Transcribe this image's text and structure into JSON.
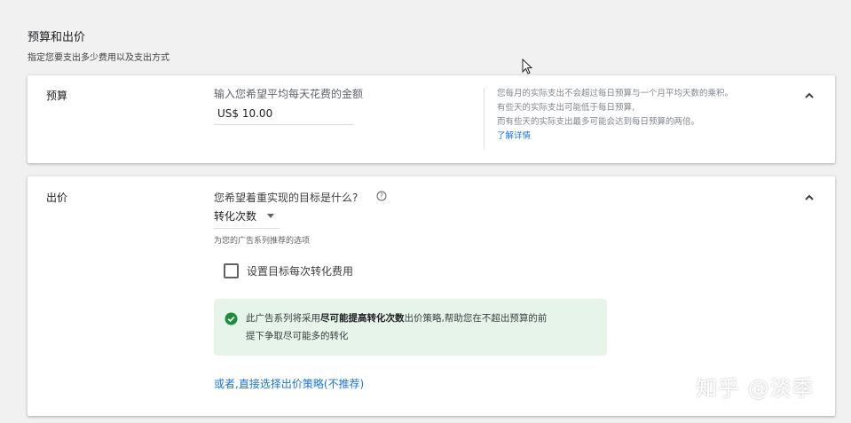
{
  "section": {
    "title": "预算和出价",
    "subtitle": "指定您要支出多少费用以及支出方式"
  },
  "budget": {
    "label": "预算",
    "prompt": "输入您希望平均每天花费的金额",
    "value": "US$ 10.00",
    "help_lines": [
      "您每月的实际支出不会超过每日预算与一个月平均天数的乘积。",
      "有些天的实际支出可能低于每日预算,",
      "而有些天的实际支出最多可能会达到每日预算的两倍。"
    ],
    "learn_more": "了解详情",
    "collapse_icon": "chevron-up-icon"
  },
  "bidding": {
    "label": "出价",
    "goal_question": "您希望着重实现的目标是什么?",
    "help_icon": "help-circle-icon",
    "goal_value": "转化次数",
    "recommend_note": "为您的广告系列推荐的选项",
    "checkbox_label": "设置目标每次转化费用",
    "checkbox_checked": false,
    "info_prefix": "此广告系列将采用",
    "info_bold": "尽可能提高转化次数",
    "info_suffix": "出价策略,帮助您在不超出预算的前",
    "info_line2": "提下争取尽可能多的转化",
    "alt_link": "或者,直接选择出价策略(不推荐)",
    "collapse_icon": "chevron-up-icon"
  },
  "watermark": "知乎 @淡季",
  "colors": {
    "accent": "#1a73e8",
    "success": "#1e8e3e",
    "info_bg": "#e6f4ea"
  }
}
